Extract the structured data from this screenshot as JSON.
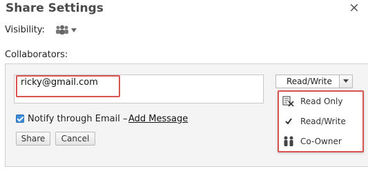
{
  "dialog": {
    "title": "Share Settings",
    "close_label": "×"
  },
  "visibility": {
    "label": "Visibility:",
    "icon": "people-icon"
  },
  "collaborators": {
    "label": "Collaborators:",
    "email_value": "ricky@gmail.com",
    "notify_label": "Notify through Email –",
    "notify_checked": true,
    "add_message_label": "Add Message",
    "share_button": "Share",
    "cancel_button": "Cancel"
  },
  "permission": {
    "selected": "Read/Write",
    "options": [
      {
        "label": "Read Only",
        "icon": "read-only-icon"
      },
      {
        "label": "Read/Write",
        "icon": "checkmark-icon"
      },
      {
        "label": "Co-Owner",
        "icon": "co-owner-icon"
      }
    ]
  },
  "colors": {
    "highlight": "#d9534f",
    "checkbox": "#3c8ddc"
  }
}
